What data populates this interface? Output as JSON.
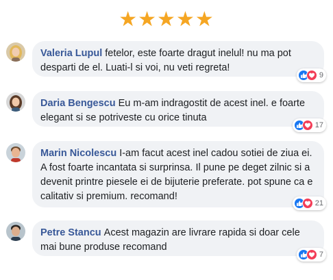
{
  "rating": {
    "stars": 5,
    "star_glyph": "★",
    "color": "#f5a623"
  },
  "comments": [
    {
      "author": "Valeria Lupul",
      "text": "fetelor, este foarte dragut inelul! nu ma pot desparti de el. Luati-l si voi, nu veti regreta!",
      "reaction_count": "9",
      "avatar": "female-avatar-blonde"
    },
    {
      "author": "Daria Bengescu",
      "text": "Eu m-am indragostit de acest inel. e foarte elegant si se potriveste cu orice tinuta",
      "reaction_count": "17",
      "avatar": "female-avatar-brunette"
    },
    {
      "author": "Marin Nicolescu",
      "text": "I-am facut acest inel cadou sotiei de ziua ei. A fost foarte incantata si surprinsa. Il pune pe deget zilnic si a devenit printre piesele ei de bijuterie preferate. pot spune ca e calitativ si premium. recomand!",
      "reaction_count": "21",
      "avatar": "male-avatar-smiling"
    },
    {
      "author": "Petre Stancu",
      "text": "Acest magazin are livrare rapida si doar cele mai bune produse recomand",
      "reaction_count": "7",
      "avatar": "male-avatar-dark-hair"
    }
  ],
  "colors": {
    "bubble": "#f0f2f5",
    "author": "#385898",
    "like": "#1877f2",
    "love": "#f33e58"
  }
}
